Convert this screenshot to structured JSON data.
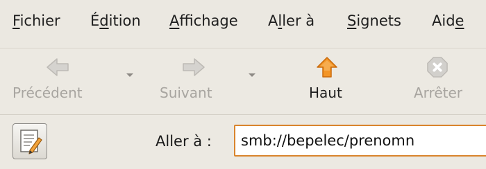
{
  "menubar": {
    "items": [
      {
        "pre": "",
        "u": "F",
        "post": "ichier"
      },
      {
        "pre": "É",
        "u": "d",
        "post": "ition"
      },
      {
        "pre": "",
        "u": "A",
        "post": "ffichage"
      },
      {
        "pre": "A",
        "u": "l",
        "post": "ler à"
      },
      {
        "pre": "",
        "u": "S",
        "post": "ignets"
      },
      {
        "pre": "Aid",
        "u": "e",
        "post": ""
      }
    ]
  },
  "toolbar": {
    "back": {
      "label": "Précédent",
      "icon": "arrow-left-icon",
      "enabled": false
    },
    "forward": {
      "label": "Suivant",
      "icon": "arrow-right-icon",
      "enabled": false
    },
    "up": {
      "label": "Haut",
      "icon": "arrow-up-icon",
      "enabled": true,
      "color": "#f08c1c"
    },
    "stop": {
      "label": "Arrêter",
      "icon": "stop-icon",
      "enabled": false
    }
  },
  "location": {
    "toggle_icon": "edit-location-icon",
    "label": "Aller à :",
    "value": "smb://bepelec/prenomn"
  }
}
